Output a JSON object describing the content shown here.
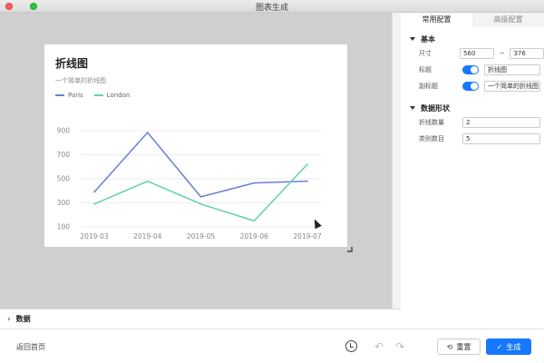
{
  "window": {
    "title": "图表生成"
  },
  "chart_card": {
    "title": "折线图",
    "subtitle": "一个简单的折线图"
  },
  "chart_data": {
    "type": "line",
    "title": "折线图",
    "subtitle": "一个简单的折线图",
    "categories": [
      "2019-03",
      "2019-04",
      "2019-05",
      "2019-06",
      "2019-07"
    ],
    "series": [
      {
        "name": "Paris",
        "values": [
          390,
          885,
          350,
          465,
          480
        ],
        "color": "#6b7fd6"
      },
      {
        "name": "London",
        "values": [
          290,
          480,
          290,
          150,
          620
        ],
        "color": "#5fd3a4"
      }
    ],
    "ylim": [
      100,
      900
    ],
    "yticks": [
      100,
      300,
      500,
      700,
      900
    ],
    "grid": true,
    "legend": "top-left"
  },
  "panel": {
    "tabs": [
      "常用配置",
      "高级配置"
    ],
    "basic": {
      "heading": "基本",
      "size_label": "尺寸",
      "width": "560",
      "tilde": "~",
      "height": "376",
      "title_label": "标题",
      "title_value": "折线图",
      "subtitle_label": "副标题",
      "subtitle_value": "一个简单的折线图"
    },
    "shape": {
      "heading": "数据形状",
      "lines_label": "折线数量",
      "lines_value": "2",
      "cats_label": "类别数目",
      "cats_value": "5"
    }
  },
  "data_section": {
    "label": "数据"
  },
  "bottom": {
    "back": "返回首页",
    "reset": "重置",
    "generate": "生成"
  }
}
